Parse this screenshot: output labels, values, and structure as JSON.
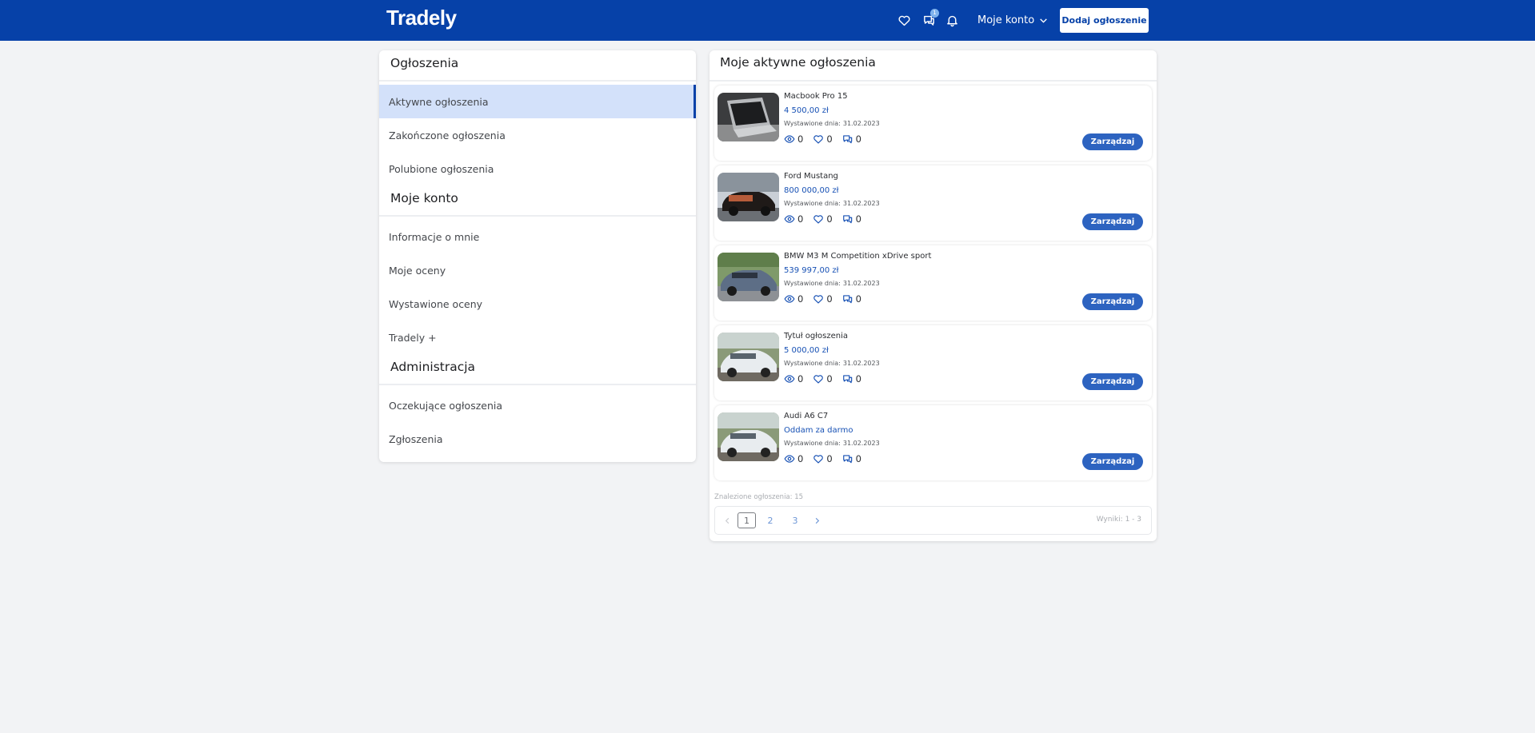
{
  "header": {
    "brand": "Tradely",
    "messages_badge": "1",
    "account_label": "Moje konto",
    "add_button": "Dodaj ogłoszenie",
    "colors": {
      "brand": "#0641a8",
      "accent": "#2d63c0"
    }
  },
  "sidebar": {
    "sections": [
      {
        "title": "Ogłoszenia",
        "items": [
          "Aktywne ogłoszenia",
          "Zakończone ogłoszenia",
          "Polubione ogłoszenia"
        ]
      },
      {
        "title": "Moje konto",
        "items": [
          "Informacje o mnie",
          "Moje oceny",
          "Wystawione oceny",
          "Tradely +"
        ]
      },
      {
        "title": "Administracja",
        "items": [
          "Oczekujące ogłoszenia",
          "Zgłoszenia"
        ]
      }
    ],
    "active_item": "Aktywne ogłoszenia"
  },
  "main": {
    "title": "Moje aktywne ogłoszenia",
    "date_label": "Wystawione dnia:",
    "manage_label": "Zarządzaj",
    "listings": [
      {
        "title": "Macbook Pro 15",
        "price": "4 500,00 zł",
        "date": "31.02.2023",
        "views": "0",
        "likes": "0",
        "comments": "0",
        "image": "laptop"
      },
      {
        "title": "Ford Mustang",
        "price": "800 000,00 zł",
        "date": "31.02.2023",
        "views": "0",
        "likes": "0",
        "comments": "0",
        "image": "dark-car"
      },
      {
        "title": "BMW M3 M Competition xDrive sport",
        "price": "539 997,00 zł",
        "date": "31.02.2023",
        "views": "0",
        "likes": "0",
        "comments": "0",
        "image": "grey-car"
      },
      {
        "title": "Tytuł ogłoszenia",
        "price": "5 000,00 zł",
        "date": "31.02.2023",
        "views": "0",
        "likes": "0",
        "comments": "0",
        "image": "white-car"
      },
      {
        "title": "Audi A6 C7",
        "price": "Oddam za darmo",
        "date": "31.02.2023",
        "views": "0",
        "likes": "0",
        "comments": "0",
        "image": "white-car"
      }
    ],
    "found_text": "Znalezione ogłoszenia: 15",
    "pagination": {
      "pages": [
        "1",
        "2",
        "3"
      ],
      "current": "1",
      "results_text": "Wyniki: 1 - 3"
    }
  }
}
